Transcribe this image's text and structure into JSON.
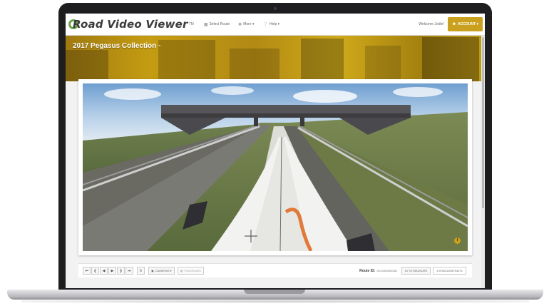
{
  "navbar": {
    "brand": "Road Video Viewer",
    "brand_tm": "TM",
    "links": [
      {
        "icon": "road-icon",
        "label": "Select Route"
      },
      {
        "icon": "plus-icon",
        "label": "More ▾"
      },
      {
        "icon": "question-icon",
        "label": "Help ▾"
      }
    ],
    "welcome": "Welcome Jodie!",
    "account_label": "ACCOUNT ▾",
    "account_icon": "user-icon"
  },
  "banner": {
    "title": "2017 Pegasus Collection -"
  },
  "viewer": {
    "info_icon": "i",
    "crosshair_icon": "crosshair-icon"
  },
  "controls": {
    "buttons": [
      "⏮",
      "❮",
      "◀",
      "▶",
      "❯",
      "⏭"
    ],
    "refresh": "↻",
    "cameras_label": "CAMERAS ▾",
    "panoramic_label": "PANORAMIC",
    "route_label": "Route ID:",
    "route_value": "0K100N40000B",
    "measure_label": "IO TO MEASURE",
    "coordinate_value": "3.976022226704271"
  },
  "colors": {
    "accent": "#c9a11e",
    "brand_ring": "#6da54a"
  }
}
